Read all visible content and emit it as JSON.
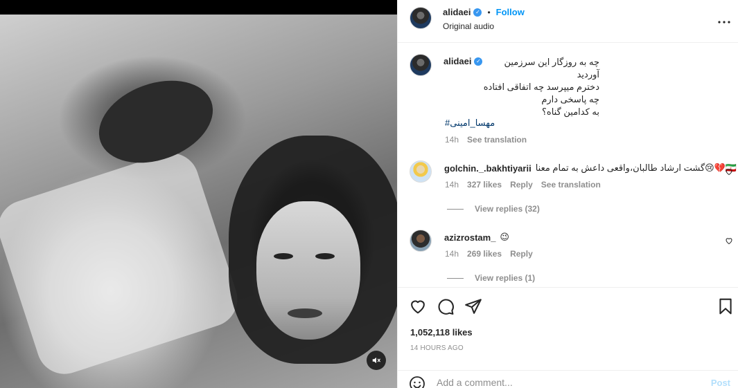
{
  "post": {
    "username": "alidaei",
    "verified": true,
    "follow_label": "Follow",
    "audio": "Original audio",
    "more_icon": "more-horizontal-icon"
  },
  "caption": {
    "username": "alidaei",
    "lines": [
      "چه به روزگار این سرزمین آوردید",
      "دخترم میپرسد چه اتفاقی افتاده",
      "چه پاسخی دارم",
      "به کدامین گناه؟"
    ],
    "hashtag": "#مهسا_امینی",
    "time": "14h",
    "see_translation": "See translation"
  },
  "comments": [
    {
      "username": "golchin._.bakhtiyarii",
      "text": "گشت ارشاد طالبان،واقعی داعش به تمام معنا😢💔🇮🇷",
      "time": "14h",
      "likes": "327 likes",
      "reply": "Reply",
      "see_translation": "See translation",
      "view_replies": "View replies (32)"
    },
    {
      "username": "azizrostam_",
      "text": "😉",
      "time": "14h",
      "likes": "269 likes",
      "reply": "Reply",
      "view_replies": "View replies (1)"
    }
  ],
  "actions": {
    "likes": "1,052,118 likes",
    "time_ago": "14 HOURS AGO"
  },
  "add_comment": {
    "placeholder": "Add a comment...",
    "post_label": "Post"
  },
  "colors": {
    "accent": "#0095f6",
    "muted": "#8e8e8e",
    "hashtag": "#00376b",
    "post_disabled": "#b2dffc"
  }
}
